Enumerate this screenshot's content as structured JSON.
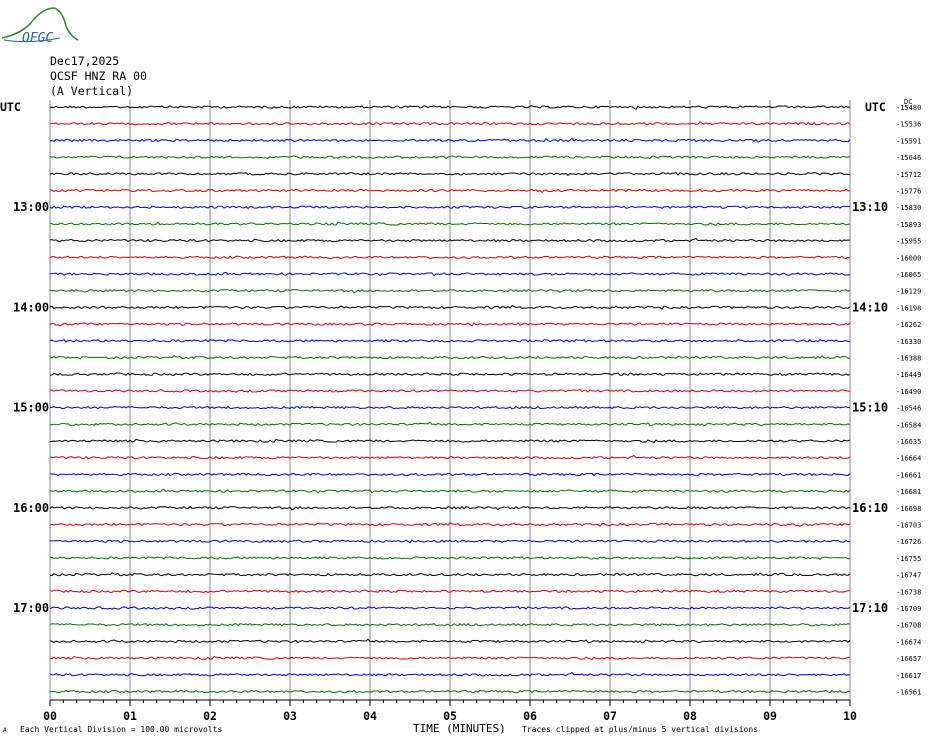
{
  "logo": {
    "text": "OFGC"
  },
  "header": {
    "date": "Dec17,2025",
    "station": "OCSF HNZ RA 00",
    "component": "(A Vertical)"
  },
  "utc_left": "UTC",
  "utc_right": "UTC",
  "dc_label": "DC",
  "footer": {
    "x_axis_title": "TIME (MINUTES)",
    "division_note": "Each Vertical Division =  100.00 microvolts",
    "clip_note": "Traces clipped at plus/minus 5 vertical divisions",
    "corner_mark": "A"
  },
  "colors": {
    "cycle": [
      "#000000",
      "#dd0000",
      "#0000dd",
      "#007700"
    ],
    "grid": "#888888"
  },
  "chart_data": {
    "type": "line",
    "title": "",
    "xlabel": "TIME (MINUTES)",
    "xlim": [
      0,
      10
    ],
    "x_ticks": [
      "00",
      "01",
      "02",
      "03",
      "04",
      "05",
      "06",
      "07",
      "08",
      "09",
      "10"
    ],
    "trace_count": 36,
    "left_hour_labels": [
      {
        "trace": 6,
        "label": "13:00"
      },
      {
        "trace": 12,
        "label": "14:00"
      },
      {
        "trace": 18,
        "label": "15:00"
      },
      {
        "trace": 24,
        "label": "16:00"
      },
      {
        "trace": 30,
        "label": "17:00"
      }
    ],
    "right_hour_labels": [
      {
        "trace": 6,
        "label": "13:10"
      },
      {
        "trace": 12,
        "label": "14:10"
      },
      {
        "trace": 18,
        "label": "15:10"
      },
      {
        "trace": 24,
        "label": "16:10"
      },
      {
        "trace": 30,
        "label": "17:10"
      }
    ],
    "dc_offsets": [
      "-15480",
      "-15536",
      "-15591",
      "-15646",
      "-15712",
      "-15776",
      "-15830",
      "-15893",
      "-15955",
      "-16000",
      "-16065",
      "-16129",
      "-16198",
      "-16262",
      "-16330",
      "-16388",
      "-16449",
      "-16490",
      "-16546",
      "-16584",
      "-16635",
      "-16664",
      "-16661",
      "-16681",
      "-16698",
      "-16703",
      "-16726",
      "-16755",
      "-16747",
      "-16738",
      "-16709",
      "-16708",
      "-16674",
      "-16657",
      "-16617",
      "-16561"
    ]
  }
}
